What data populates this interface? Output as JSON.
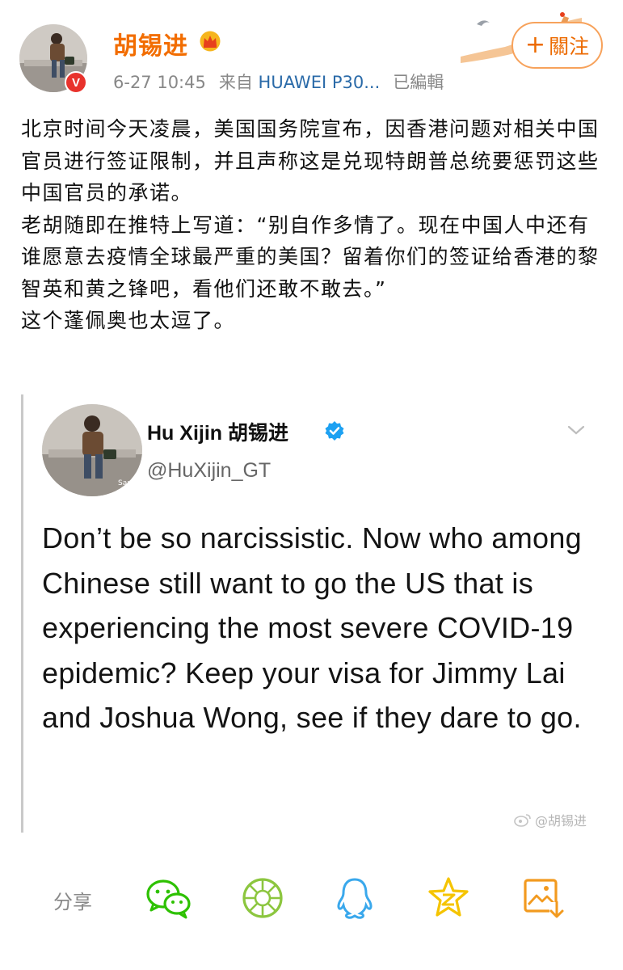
{
  "post": {
    "author": "胡锡进",
    "date": "6-27 10:45",
    "source_prefix": "来自",
    "source_device": "HUAWEI P30...",
    "edited": "已編輯",
    "follow_label": "關注",
    "paragraphs": [
      "北京时间今天凌晨，美国国务院宣布，因香港问题对相关中国官员进行签证限制，并且声称这是兑现特朗普总统要惩罚这些中国官员的承诺。",
      "老胡随即在推特上写道：“别自作多情了。现在中国人中还有谁愿意去疫情全球最严重的美国？留着你们的签证给香港的黎智英和黄之锋吧，看他们还敢不敢去。”",
      "这个蓬佩奥也太逗了。"
    ]
  },
  "tweet": {
    "name": "Hu Xijin 胡锡进",
    "handle": "@HuXijin_GT",
    "body": "Don’t be so narcissistic. Now who among Chinese still want to go the US that is experiencing the most severe COVID-19 epidemic? Keep your visa for Jimmy Lai and Joshua Wong, see if they dare to go.",
    "avatar_caption": "Sarajo",
    "watermark": "@胡锡进"
  },
  "share": {
    "label": "分享",
    "icons": [
      "wechat-icon",
      "moments-icon",
      "qq-icon",
      "qzone-icon",
      "save-image-icon"
    ],
    "colors": {
      "wechat": "#2dc100",
      "moments": "#8cc63f",
      "qq": "#3aa8ec",
      "qzone": "#f5c400",
      "save": "#f29a1f"
    }
  },
  "colors": {
    "username": "#f26d00",
    "source": "#2a6aa8",
    "follow_border": "#f7a25b",
    "verified_badge": "#e8322c",
    "tweet_check": "#1da1f2"
  }
}
